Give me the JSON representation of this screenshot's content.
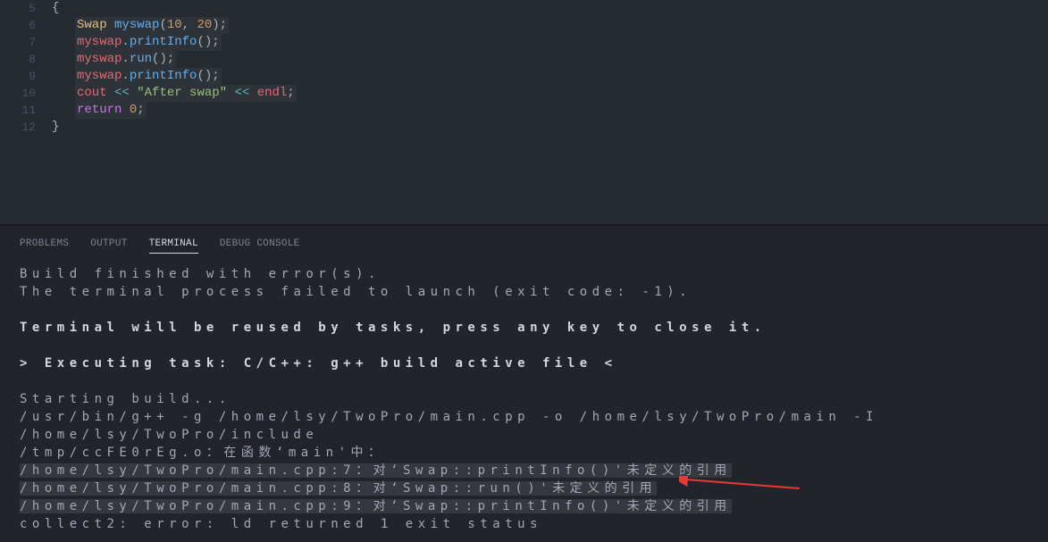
{
  "editor": {
    "lines": [
      {
        "num": "5",
        "indent": 1,
        "tokens": [
          {
            "cls": "tok-punct",
            "t": "{"
          }
        ]
      },
      {
        "num": "6",
        "indent": 2,
        "tokens": [
          {
            "cls": "tok-type",
            "t": "Swap"
          },
          {
            "cls": "tok-plain",
            "t": " "
          },
          {
            "cls": "tok-func",
            "t": "myswap"
          },
          {
            "cls": "tok-punct",
            "t": "("
          },
          {
            "cls": "tok-num",
            "t": "10"
          },
          {
            "cls": "tok-punct",
            "t": ", "
          },
          {
            "cls": "tok-num",
            "t": "20"
          },
          {
            "cls": "tok-punct",
            "t": ");"
          }
        ],
        "hl": true
      },
      {
        "num": "7",
        "indent": 2,
        "tokens": [
          {
            "cls": "tok-var",
            "t": "myswap"
          },
          {
            "cls": "tok-punct",
            "t": "."
          },
          {
            "cls": "tok-func",
            "t": "printInfo"
          },
          {
            "cls": "tok-punct",
            "t": "();"
          }
        ],
        "hl": true
      },
      {
        "num": "8",
        "indent": 2,
        "tokens": [
          {
            "cls": "tok-var",
            "t": "myswap"
          },
          {
            "cls": "tok-punct",
            "t": "."
          },
          {
            "cls": "tok-func",
            "t": "run"
          },
          {
            "cls": "tok-punct",
            "t": "();"
          }
        ],
        "hl": true
      },
      {
        "num": "9",
        "indent": 2,
        "tokens": [
          {
            "cls": "tok-var",
            "t": "myswap"
          },
          {
            "cls": "tok-punct",
            "t": "."
          },
          {
            "cls": "tok-func",
            "t": "printInfo"
          },
          {
            "cls": "tok-punct",
            "t": "();"
          }
        ],
        "hl": true
      },
      {
        "num": "10",
        "indent": 2,
        "tokens": [
          {
            "cls": "tok-var",
            "t": "cout"
          },
          {
            "cls": "tok-plain",
            "t": " "
          },
          {
            "cls": "tok-op",
            "t": "<<"
          },
          {
            "cls": "tok-plain",
            "t": " "
          },
          {
            "cls": "tok-str",
            "t": "\"After swap\""
          },
          {
            "cls": "tok-plain",
            "t": " "
          },
          {
            "cls": "tok-op",
            "t": "<<"
          },
          {
            "cls": "tok-plain",
            "t": " "
          },
          {
            "cls": "tok-var",
            "t": "endl"
          },
          {
            "cls": "tok-punct",
            "t": ";"
          }
        ],
        "hl": true
      },
      {
        "num": "11",
        "indent": 2,
        "tokens": [
          {
            "cls": "tok-keyword",
            "t": "return"
          },
          {
            "cls": "tok-plain",
            "t": " "
          },
          {
            "cls": "tok-num",
            "t": "0"
          },
          {
            "cls": "tok-punct",
            "t": ";"
          }
        ],
        "hl": true
      },
      {
        "num": "12",
        "indent": 1,
        "tokens": [
          {
            "cls": "tok-punct",
            "t": "}"
          }
        ]
      }
    ]
  },
  "panel_tabs": {
    "problems": "PROBLEMS",
    "output": "OUTPUT",
    "terminal": "TERMINAL",
    "debug_console": "DEBUG CONSOLE",
    "active": "terminal"
  },
  "terminal": {
    "lines": [
      {
        "t": "Build finished with error(s).",
        "bold": false
      },
      {
        "t": "The terminal process failed to launch (exit code: -1).",
        "bold": false
      },
      {
        "t": "",
        "bold": false
      },
      {
        "t": "Terminal will be reused by tasks, press any key to close it.",
        "bold": true
      },
      {
        "t": "",
        "bold": false
      },
      {
        "t": "> Executing task: C/C++: g++ build active file <",
        "bold": true
      },
      {
        "t": "",
        "bold": false
      },
      {
        "t": "Starting build...",
        "bold": false
      },
      {
        "t": "/usr/bin/g++ -g /home/lsy/TwoPro/main.cpp -o /home/lsy/TwoPro/main -I /home/lsy/TwoPro/include",
        "bold": false
      },
      {
        "t": "/tmp/ccFE0rEg.o：在函数‘main'中：",
        "bold": false
      },
      {
        "t": "/home/lsy/TwoPro/main.cpp:7：对‘Swap::printInfo()'未定义的引用",
        "bold": false,
        "hl": true
      },
      {
        "t": "/home/lsy/TwoPro/main.cpp:8：对‘Swap::run()'未定义的引用",
        "bold": false,
        "hl": true
      },
      {
        "t": "/home/lsy/TwoPro/main.cpp:9：对‘Swap::printInfo()'未定义的引用",
        "bold": false,
        "hl": true
      },
      {
        "t": "collect2: error: ld returned 1 exit status",
        "bold": false
      }
    ]
  }
}
